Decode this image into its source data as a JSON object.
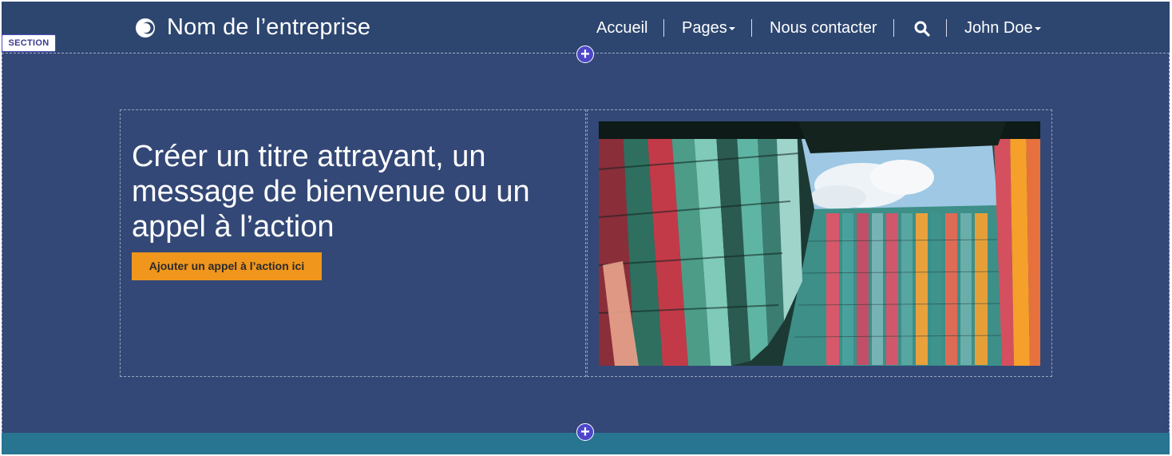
{
  "header": {
    "brand_name": "Nom de l’entreprise",
    "logo_icon": "circle-logo-icon",
    "nav": {
      "home": "Accueil",
      "pages": "Pages",
      "contact": "Nous contacter",
      "search_icon": "search-icon",
      "user": "John Doe"
    }
  },
  "editor": {
    "section_tag": "SECTION",
    "add_icon": "+"
  },
  "hero": {
    "title": "Créer un titre attrayant, un message de bienvenue ou un appel à l’action",
    "cta_label": "Ajouter un appel à l’action ici",
    "image_subject": "colorful-building-facade-photo"
  },
  "colors": {
    "header_bg": "#2d4670",
    "section_bg": "#334876",
    "cta_bg": "#f0961c",
    "footer_band": "#287592",
    "add_button": "#4d46c9"
  }
}
